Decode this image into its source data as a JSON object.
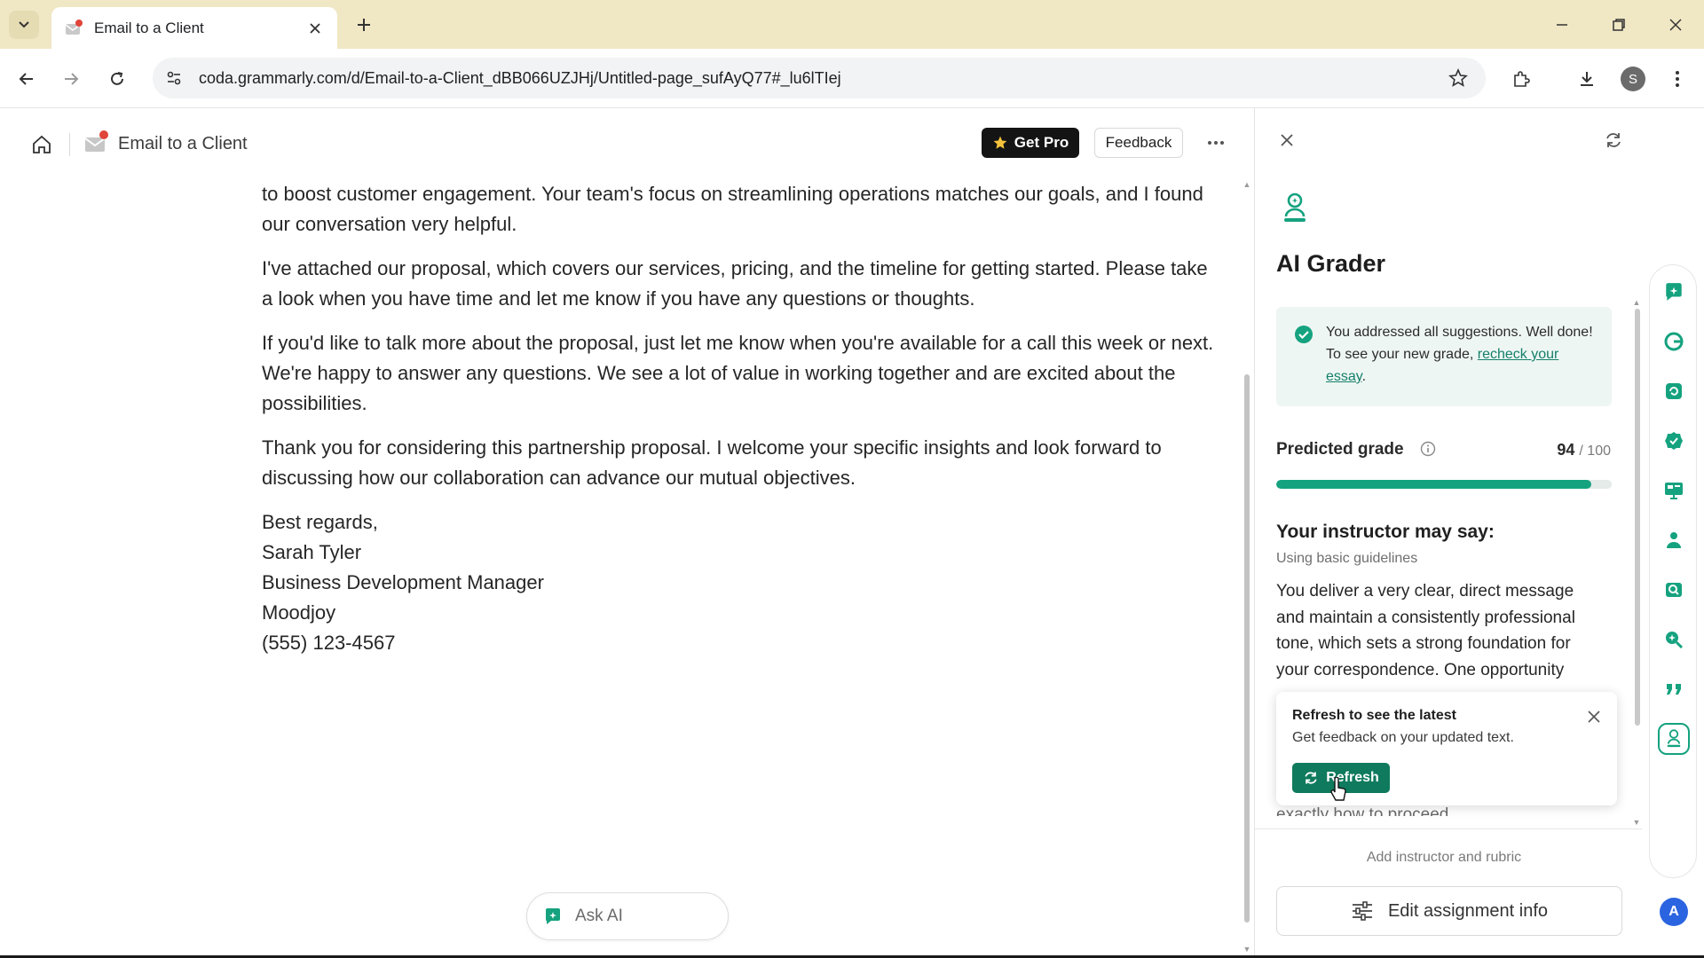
{
  "browser": {
    "tab_title": "Email to a Client",
    "url": "coda.grammarly.com/d/Email-to-a-Client_dBB066UZJHj/Untitled-page_sufAyQ77#_lu6lTIej",
    "profile_initial": "S"
  },
  "doc": {
    "title": "Email to a Client",
    "get_pro_label": "Get Pro",
    "feedback_label": "Feedback",
    "paragraphs": [
      "to boost customer engagement. Your team's focus on streamlining operations matches our goals, and I found our conversation very helpful.",
      "I've attached our proposal, which covers our services, pricing, and the timeline for getting started. Please take a look when you have time and let me know if you have any questions or thoughts.",
      "If you'd like to talk more about the proposal, just let me know when you're available for a call this week or next. We're happy to answer any questions. We see a lot of value in working together and are excited about the possibilities.",
      "Thank you for considering this partnership proposal. I welcome your specific insights and look forward to discussing how our collaboration can advance our mutual objectives."
    ],
    "signature": [
      "Best regards,",
      "Sarah Tyler",
      "Business Development Manager",
      "Moodjoy",
      "(555) 123-4567"
    ],
    "ask_ai_label": "Ask AI"
  },
  "panel": {
    "title": "AI Grader",
    "success_text": "You addressed all suggestions. Well done! To see your new grade, ",
    "success_link": "recheck your essay",
    "success_end": ".",
    "grade_label": "Predicted grade",
    "grade_value": "94",
    "grade_max": "/ 100",
    "grade_fraction": 0.94,
    "instructor_title": "Your instructor may say:",
    "instructor_sub": "Using basic guidelines",
    "instructor_text": "You deliver a very clear, direct message and maintain a consistently professional tone, which sets a strong foundation for your correspondence. One opportunity",
    "instructor_cut": "exactly how to proceed.",
    "popover_title": "Refresh to see the latest",
    "popover_text": "Get feedback on your updated text.",
    "popover_button": "Refresh",
    "add_instructor": "Add instructor and rubric",
    "edit_assignment": "Edit assignment info"
  },
  "rail": {
    "avatar_initial": "A"
  },
  "colors": {
    "accent_green": "#15a27f",
    "button_green": "#0f7a5d",
    "tabbar": "#f0e7c4"
  }
}
